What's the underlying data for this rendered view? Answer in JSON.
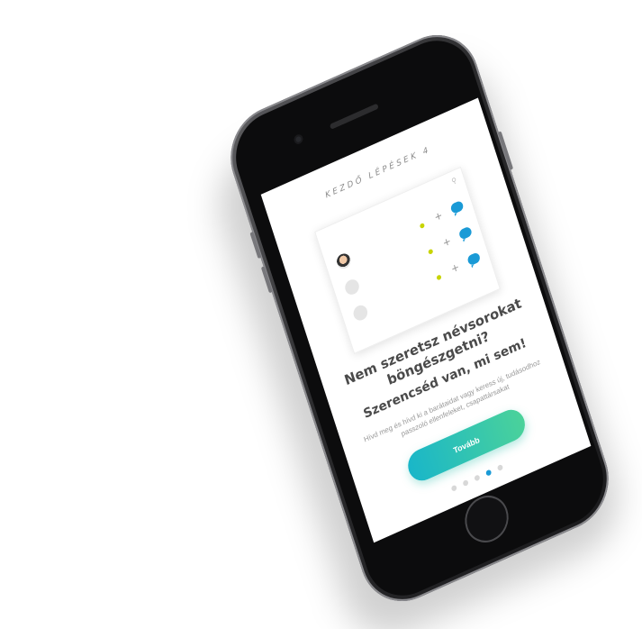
{
  "screen": {
    "title": "KEZDŐ LÉPÉSEK 4",
    "headline": "Nem szeretsz névsorokat böngészgetni?",
    "subhead": "Szerencséd van, mi sem!",
    "description": "Hívd meg és hívd ki a barátaidat vagy keress új, tudásodhoz passzoló ellenfeleket, csapattársakat",
    "next_button": "Tovább",
    "dots": {
      "count": 5,
      "active_index": 3
    }
  },
  "colors": {
    "accent_blue": "#1a9ad6",
    "button_gradient_start": "#19b6c9",
    "button_gradient_end": "#4bd29a",
    "highlight_yellow": "#c8d400"
  }
}
